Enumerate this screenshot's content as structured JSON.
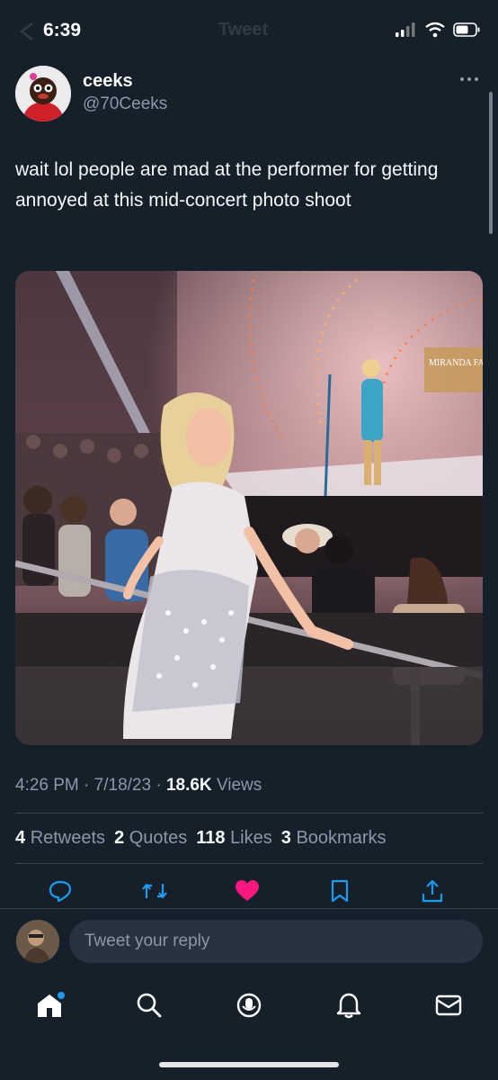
{
  "status_bar": {
    "time": "6:39"
  },
  "nav": {
    "ghost_title": "Tweet"
  },
  "tweet": {
    "author_name": "ceeks",
    "author_handle": "@70Ceeks",
    "text": "wait lol people are mad at the performer for getting annoyed at this mid-concert photo shoot",
    "media_sign_text": "MIRANDA FASTEST G",
    "meta": {
      "time": "4:26 PM",
      "dot1": "·",
      "date": "7/18/23",
      "dot2": "·",
      "views_count": "18.6K",
      "views_label": "Views"
    },
    "stats": [
      {
        "count": "4",
        "label": "Retweets"
      },
      {
        "count": "2",
        "label": "Quotes"
      },
      {
        "count": "118",
        "label": "Likes"
      },
      {
        "count": "3",
        "label": "Bookmarks"
      }
    ]
  },
  "actions": {
    "reply": "reply-icon",
    "retweet": "retweet-icon",
    "like": "heart-icon",
    "bookmark": "bookmark-icon",
    "share": "share-icon"
  },
  "reply_bar": {
    "placeholder": "Tweet your reply"
  },
  "tab_bar": [
    "home-icon",
    "search-icon",
    "spaces-icon",
    "notifications-icon",
    "messages-icon"
  ],
  "colors": {
    "background": "#15202b",
    "like": "#f91880",
    "accent": "#1d9bf0",
    "muted": "#8b98a5"
  }
}
